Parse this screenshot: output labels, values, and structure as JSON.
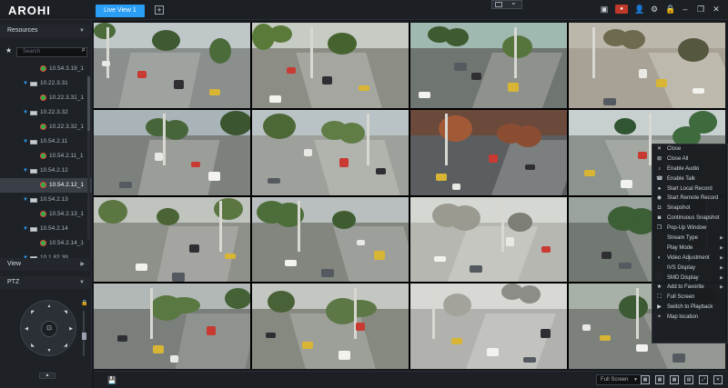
{
  "app": {
    "logo": "AROHI"
  },
  "tabs": [
    {
      "label": "Live View 1"
    }
  ],
  "topbar": {
    "add_icon": "+",
    "layout_icon": "grid-icon",
    "chevron": "⌄",
    "rec": "●"
  },
  "left": {
    "resources": "Resources",
    "search_placeholder": "Search",
    "view": "View",
    "ptz": "PTZ",
    "tree": [
      {
        "type": "cam",
        "label": "10.54.3.19_1",
        "selected": false
      },
      {
        "type": "dev",
        "label": "10.22.3.31"
      },
      {
        "type": "cam",
        "label": "10.22.3.31_1",
        "selected": false
      },
      {
        "type": "dev",
        "label": "10.22.3.32"
      },
      {
        "type": "cam",
        "label": "10.22.3.32_1",
        "selected": false
      },
      {
        "type": "dev",
        "label": "10.54.2.11"
      },
      {
        "type": "cam",
        "label": "10.54.2.11_1",
        "selected": false
      },
      {
        "type": "dev",
        "label": "10.54.2.12"
      },
      {
        "type": "cam",
        "label": "10.54.2.12_1",
        "selected": true
      },
      {
        "type": "dev",
        "label": "10.54.2.13"
      },
      {
        "type": "cam",
        "label": "10.54.2.13_1",
        "selected": false
      },
      {
        "type": "dev",
        "label": "10.54.2.14"
      },
      {
        "type": "cam",
        "label": "10.54.2.14_1",
        "selected": false
      },
      {
        "type": "dev",
        "label": "10.1.82.39"
      }
    ]
  },
  "context_menu": [
    {
      "label": "Close",
      "icon": "✕",
      "sub": false
    },
    {
      "label": "Close All",
      "icon": "⊠",
      "sub": false
    },
    {
      "label": "Enable Audio",
      "icon": "♪",
      "sub": false
    },
    {
      "label": "Enable Talk",
      "icon": "☎",
      "sub": false
    },
    {
      "label": "Start Local Record",
      "icon": "●",
      "sub": false
    },
    {
      "label": "Start Remote Record",
      "icon": "◉",
      "sub": false
    },
    {
      "label": "Snapshot",
      "icon": "◘",
      "sub": false
    },
    {
      "label": "Continuous Snapshot",
      "icon": "◙",
      "sub": false
    },
    {
      "label": "Pop-Up Window",
      "icon": "❐",
      "sub": false
    },
    {
      "label": "Stream Type",
      "icon": "",
      "sub": true
    },
    {
      "label": "Play Mode",
      "icon": "",
      "sub": true
    },
    {
      "label": "Video Adjustment",
      "icon": "◐",
      "sub": true
    },
    {
      "label": "IVS Display",
      "icon": "",
      "sub": true
    },
    {
      "label": "SMD Display",
      "icon": "",
      "sub": true
    },
    {
      "label": "Add to Favorite",
      "icon": "★",
      "sub": true
    },
    {
      "label": "Full Screen",
      "icon": "⛶",
      "sub": false
    },
    {
      "label": "Switch to Playback",
      "icon": "▶",
      "sub": false
    },
    {
      "label": "Map location",
      "icon": "⌖",
      "sub": false
    }
  ],
  "bottom": {
    "screen_mode": "Full Screen"
  },
  "colors": {
    "accent": "#2a9df4",
    "selected_row": "#3a3f47",
    "bg": "#16191d"
  }
}
